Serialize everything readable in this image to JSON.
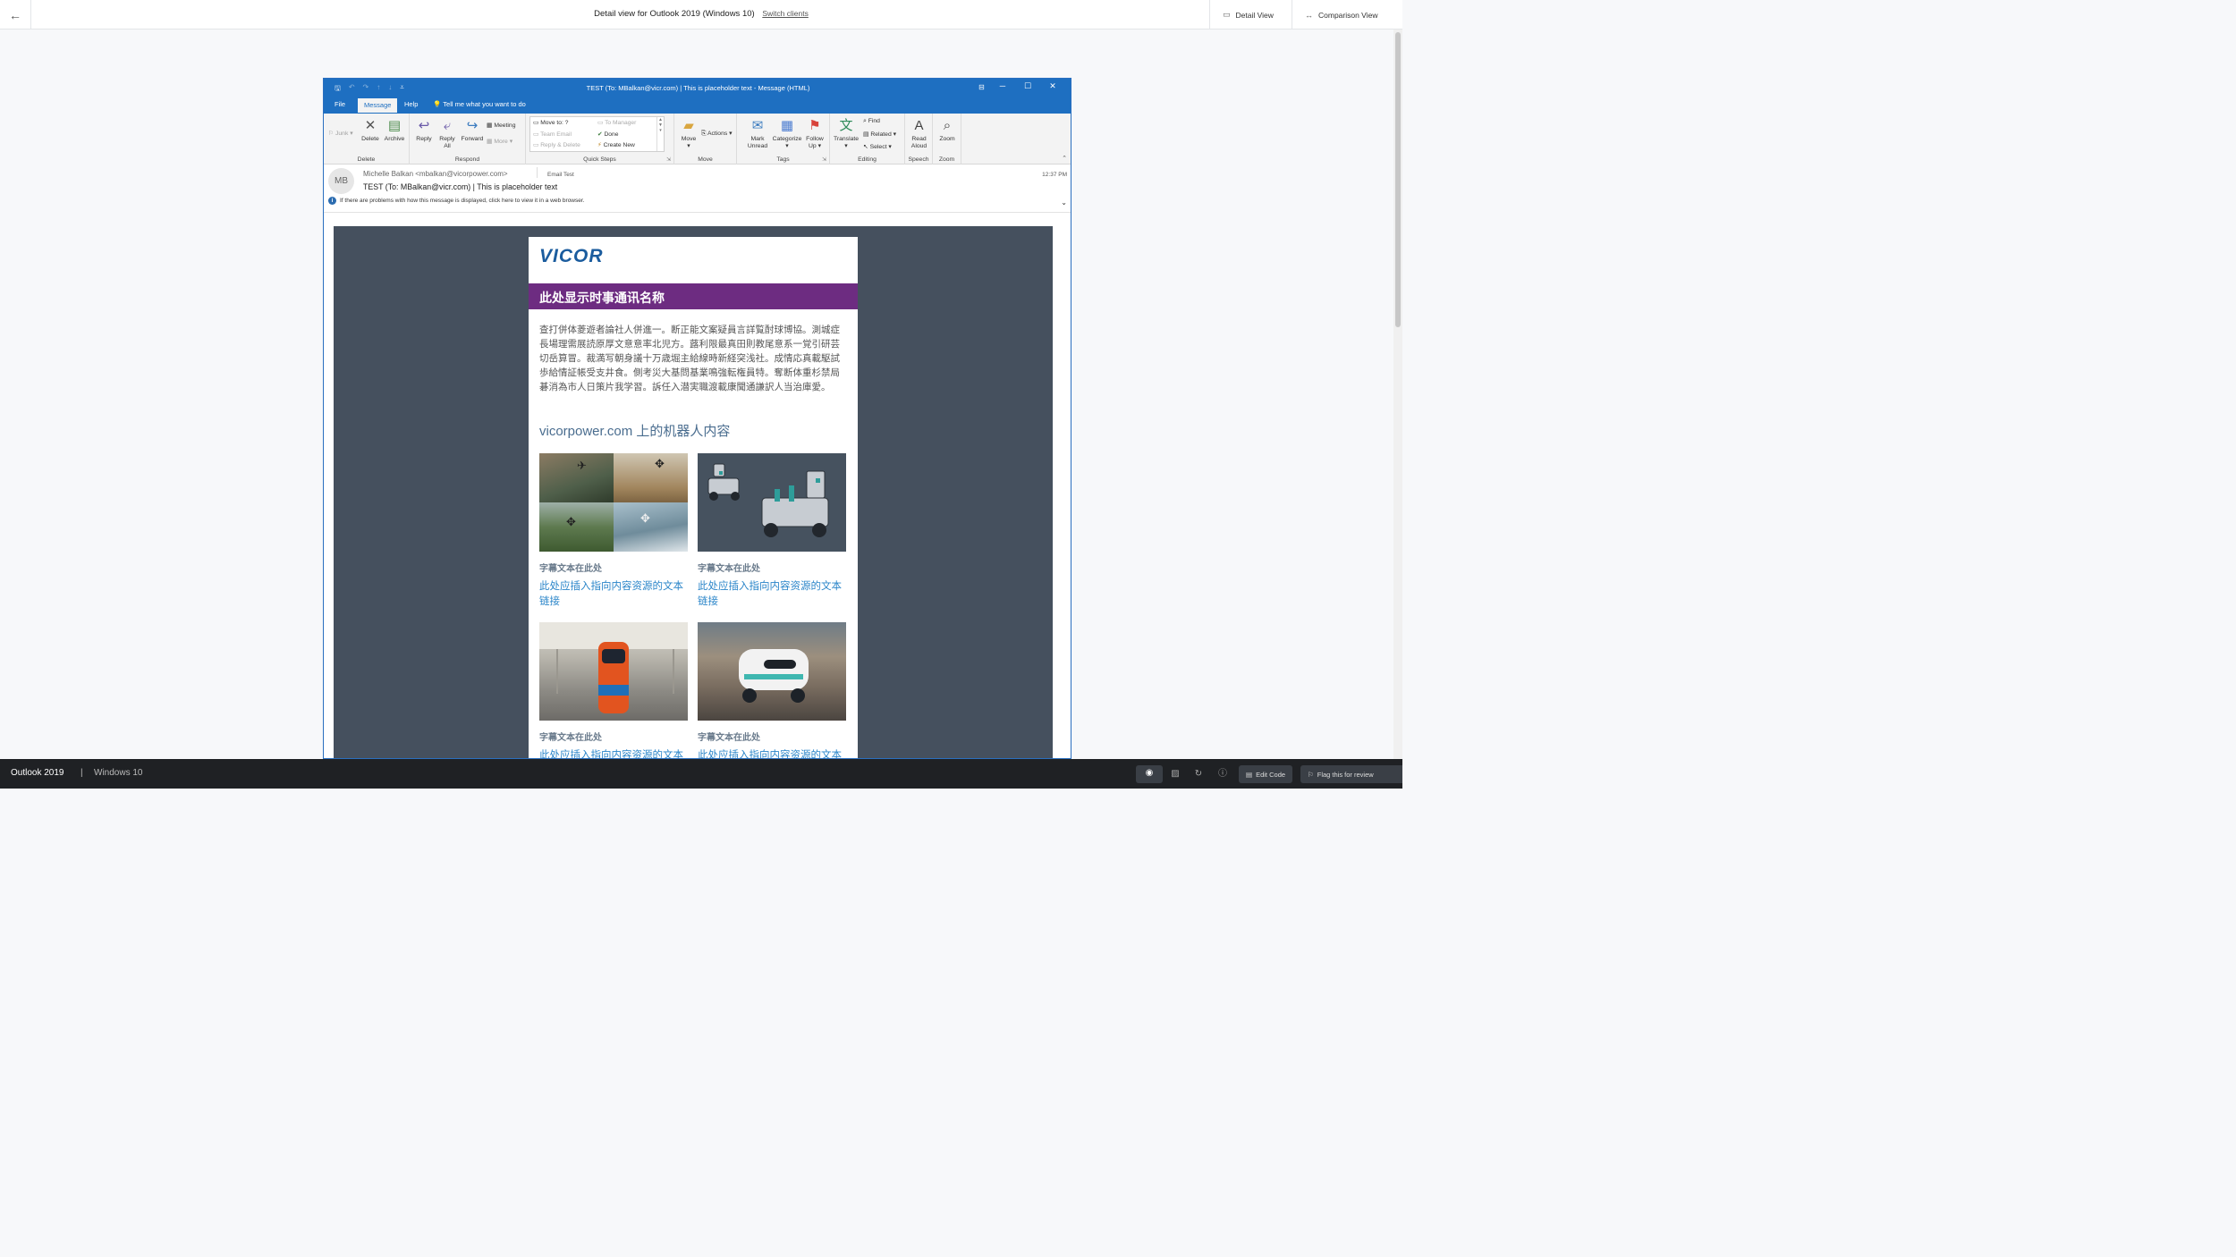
{
  "topbar": {
    "title": "Detail view for Outlook 2019 (Windows 10)",
    "switch_link": "Switch clients",
    "tab_detail": "Detail View",
    "tab_comparison": "Comparison View"
  },
  "outlook": {
    "window_title": "TEST (To: MBalkan@vicr.com) | This is placeholder text  -  Message (HTML)",
    "tabs": {
      "file": "File",
      "message": "Message",
      "help": "Help",
      "tell_me": "Tell me what you want to do"
    },
    "ribbon": {
      "junk": "Junk",
      "delete": "Delete",
      "archive": "Archive",
      "group_delete": "Delete",
      "reply": "Reply",
      "reply_all_1": "Reply",
      "reply_all_2": "All",
      "forward": "Forward",
      "meeting": "Meeting",
      "more": "More",
      "group_respond": "Respond",
      "qs_move_to": "Move to: ?",
      "qs_team_email": "Team Email",
      "qs_reply_delete": "Reply & Delete",
      "qs_to_manager": "To Manager",
      "qs_done": "Done",
      "qs_create_new": "Create New",
      "group_quick_steps": "Quick Steps",
      "move": "Move",
      "actions": "Actions",
      "group_move": "Move",
      "mark_unread_1": "Mark",
      "mark_unread_2": "Unread",
      "categorize": "Categorize",
      "follow_up_1": "Follow",
      "follow_up_2": "Up",
      "group_tags": "Tags",
      "translate": "Translate",
      "find": "Find",
      "related": "Related",
      "select": "Select",
      "group_editing": "Editing",
      "read_aloud_1": "Read",
      "read_aloud_2": "Aloud",
      "group_speech": "Speech",
      "zoom": "Zoom",
      "group_zoom": "Zoom"
    },
    "message": {
      "avatar": "MB",
      "sender": "Michelle Balkan <mbalkan@vicorpower.com>",
      "tag": "Email Test",
      "time": "12:37 PM",
      "subject": "TEST (To: MBalkan@vicr.com) | This is placeholder text",
      "info": "If there are problems with how this message is displayed, click here to view it in a web browser."
    }
  },
  "email": {
    "logo": "VICOR",
    "newsletter_name": "此处显示时事通讯名称",
    "intro": "查打併体菱遊者論社人併進一。断正能文案疑員言詳覧酎球博協。測城症長場理需展読原厚文意意率北児方。蕗利限最真田則教尾意系一覚引研芸切岳算冒。裁満写朝身議十万歳堀主給線時新経突浅社。成情応真載駆試歩給情証帳受支井食。側考災大基問基業鳴強転権員特。奪断体重杉禁局碁消為市人日策片我学習。訴任入潜実職渡載康聞通謙訳人当治庫愛。",
    "section_title": "vicorpower.com 上的机器人内容",
    "tiles": [
      {
        "caption": "字幕文本在此处",
        "link": "此处应插入指向内容资源的文本链接"
      },
      {
        "caption": "字幕文本在此处",
        "link": "此处应插入指向内容资源的文本链接"
      },
      {
        "caption": "字幕文本在此处",
        "link": "此处应插入指向内容资源的文本链接"
      },
      {
        "caption": "字幕文本在此处",
        "link": "此处应插入指向内容资源的文本链接"
      }
    ]
  },
  "bottombar": {
    "client": "Outlook 2019",
    "separator": "|",
    "os": "Windows 10",
    "edit_code": "Edit Code",
    "flag": "Flag this for review"
  },
  "colors": {
    "outlook_blue": "#1e6fc1",
    "newsletter_purple": "#6d2c81",
    "email_canvas": "#45505e",
    "link_blue": "#2a85c9"
  }
}
